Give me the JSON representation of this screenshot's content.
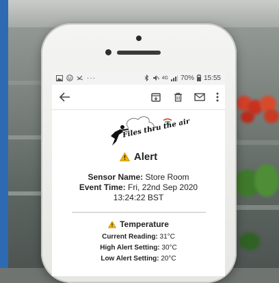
{
  "status_bar": {
    "left_icons": [
      "gallery-icon",
      "emoji-icon",
      "missed-call-icon",
      "more-dots-icon"
    ],
    "battery": "70%",
    "time": "15:55",
    "network": "4G"
  },
  "toolbar": {
    "icons": [
      "back-arrow-icon",
      "archive-icon",
      "delete-icon",
      "mail-icon",
      "more-vert-icon"
    ]
  },
  "logo": {
    "text": "Files thru the air"
  },
  "email": {
    "alert_title": "Alert",
    "sensor_label": "Sensor Name:",
    "sensor_value": "Store Room",
    "event_label": "Event Time:",
    "event_value": "Fri, 22nd Sep 2020",
    "event_time": "13:24:22 BST",
    "section_title": "Temperature",
    "readings": [
      {
        "label": "Current Reading:",
        "value": "31°C"
      },
      {
        "label": "High Alert Setting:",
        "value": "30°C"
      },
      {
        "label": "Low Alert Setting:",
        "value": "20°C"
      }
    ]
  },
  "colors": {
    "warning": "#f2b400",
    "accent_strip": "#2e6ab2",
    "logo_green": "#3aa845",
    "logo_red": "#d9342b"
  }
}
